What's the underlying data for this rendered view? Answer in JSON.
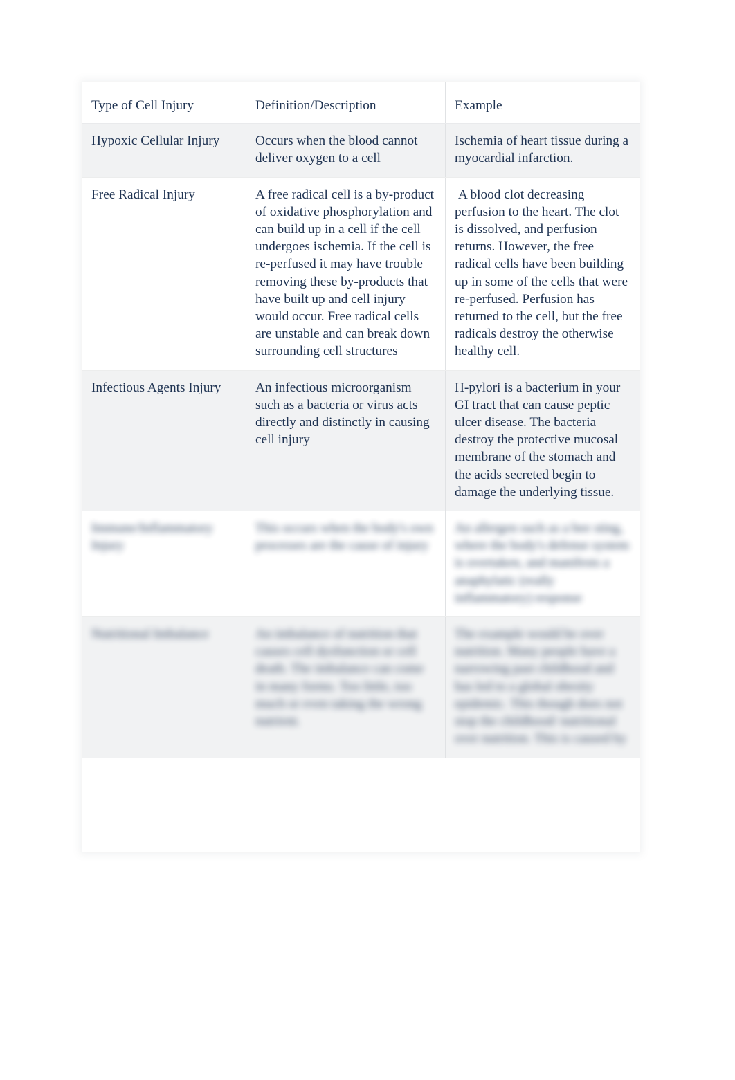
{
  "document": {
    "title": "Type of Cell Injury reference table",
    "background_color": "#ffffff",
    "text_color": "#1f3352",
    "table_shade_color": "#f1f2f3"
  },
  "table": {
    "columns": [
      {
        "id": "type",
        "header": "Type of Cell Injury"
      },
      {
        "id": "definition",
        "header": "Definition/Description"
      },
      {
        "id": "example",
        "header": "Example"
      }
    ],
    "rows": [
      {
        "shaded": true,
        "blurred": false,
        "type": "Hypoxic Cellular Injury",
        "definition": "Occurs when the blood cannot deliver oxygen to a cell",
        "example": "Ischemia of heart tissue during a myocardial infarction."
      },
      {
        "shaded": false,
        "blurred": false,
        "type": "Free Radical Injury",
        "definition": "A free radical cell is a by-product of oxidative phosphorylation and can build up in a cell if the cell undergoes ischemia. If the cell is re-perfused it may have trouble removing these by-products that have built up and cell injury would occur. Free radical cells are unstable and can break down surrounding cell structures",
        "example": " A blood clot decreasing perfusion to the heart. The clot is dissolved, and perfusion returns. However, the free radical cells have been building up in some of the cells that were re-perfused. Perfusion has returned to the cell, but the free radicals destroy the otherwise healthy cell."
      },
      {
        "shaded": true,
        "blurred": false,
        "type": "Infectious Agents Injury",
        "definition": "An infectious microorganism such as a bacteria or virus acts directly and distinctly in causing cell injury",
        "example": "H-pylori is a bacterium in your GI tract that can cause peptic ulcer disease. The bacteria destroy the protective mucosal membrane of the stomach and the acids secreted begin to damage the underlying tissue."
      },
      {
        "shaded": false,
        "blurred": true,
        "type": "Immune/Inflammatory Injury",
        "definition": "This occurs when the body's own processes are the cause of injury",
        "example": "An allergen such as a bee sting, where the body's defense system is overtaken, and manifests a anaphylatic (really inflammatory) response"
      },
      {
        "shaded": true,
        "blurred": true,
        "type": "Nutritional Imbalance",
        "definition": "An imbalance of nutrition that causes cell dysfunction or cell death. The imbalance can come in many forms. Too little, too much or even taking the wrong nutrient.",
        "example": "The example would be over nutrition. Many people have a narrowing past childhood and has led to a global obesity epidemic. This though does not stop the childhood/ nutritional over nutrition. This is caused by"
      }
    ]
  }
}
